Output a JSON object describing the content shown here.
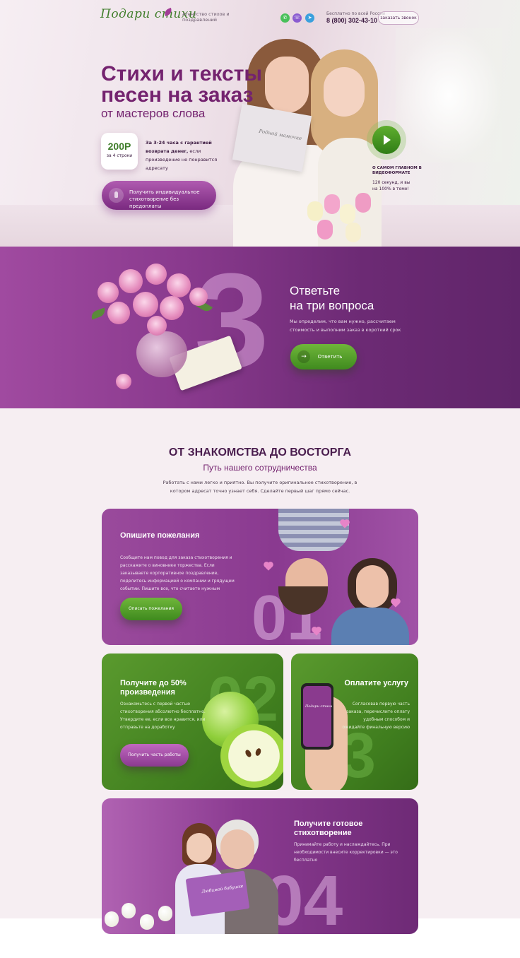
{
  "header": {
    "logo": "Подари стихи",
    "tagline": "Агентство стихов и поздравлений",
    "social_icons": [
      "whatsapp-icon",
      "viber-icon",
      "telegram-icon"
    ],
    "phone_note": "Бесплатно по всей России",
    "phone": "8 (800) 302-43-10",
    "callback_label": "заказать звонок"
  },
  "hero": {
    "title": "Стихи и тексты песен на заказ",
    "subtitle": "от мастеров слова",
    "price": "200Р",
    "price_note": "за 4 строки",
    "price_desc_bold": "За 3-24 часа с гарантией возврата денег,",
    "price_desc_rest": " если произведение не понравится адресату",
    "cta_label": "Получить индивидуальное стихотворение без предоплаты",
    "card_text": "Родной мамочке",
    "video_heading": "О САМОМ ГЛАВНОМ В ВИДЕОФОРМАТЕ",
    "video_desc": "120 секунд, и вы на 100% в теме!"
  },
  "questions": {
    "big_number": "3",
    "title_line1": "Ответьте",
    "title_line2": "на три вопроса",
    "description": "Мы определим, что вам нужно, рассчитаем стоимость и выполним заказ в короткий срок",
    "button_label": "Ответить"
  },
  "journey": {
    "title": "ОТ ЗНАКОМСТВА ДО ВОСТОРГА",
    "subtitle": "Путь нашего сотрудничества",
    "description": "Работать с нами легко и приятно. Вы получите оригинальное стихотворение, в котором адресат точно узнает себя. Сделайте первый шаг прямо сейчас.",
    "steps": [
      {
        "number": "01",
        "title": "Опишите пожелания",
        "description": "Сообщите нам повод для заказа стихотворения и расскажите о виновнике торжества. Если заказываете корпоративное поздравление, поделитесь информацией о компании и грядущем событии. Пишите все, что считаете нужным",
        "button": "Описать пожелания"
      },
      {
        "number": "02",
        "title": "Получите до 50% произведения",
        "description": "Ознакомьтесь с первой частью стихотворения абсолютно бесплатно. Утвердите ее, если все нравится, или отправьте на доработку",
        "button": "Получить часть работы"
      },
      {
        "number": "03",
        "title": "Оплатите услугу",
        "description": "Согласовав первую часть заказа, перечислите оплату удобным способом и ожидайте финальную версию",
        "phone_logo": "Подари стихи"
      },
      {
        "number": "04",
        "title": "Получите готовое стихотворение",
        "description": "Принимайте работу и наслаждайтесь. При необходимости внесите корректировки — это бесплатно",
        "card_text": "Любимой бабушке"
      }
    ]
  },
  "colors": {
    "brand_purple": "#74236f",
    "brand_green": "#3f7d1e",
    "page_bg": "#f6eef2"
  }
}
